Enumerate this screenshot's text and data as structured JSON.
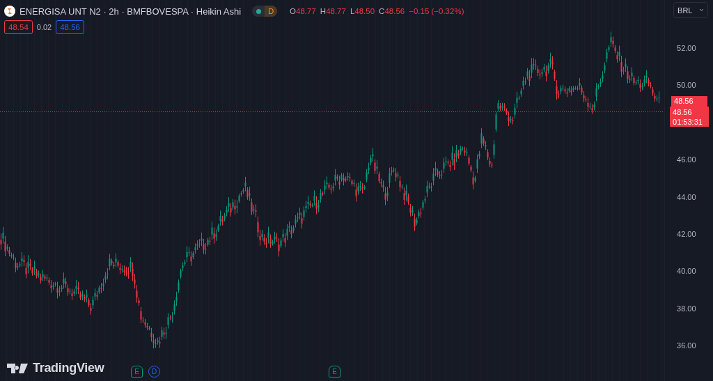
{
  "header": {
    "symbol": "ENERGISA UNT N2 · 2h · BMFBOVESPA · Heikin Ashi",
    "market_badge": "D",
    "ohlc": [
      {
        "label": "O",
        "value": "48.77"
      },
      {
        "label": "H",
        "value": "48.77"
      },
      {
        "label": "L",
        "value": "48.50"
      },
      {
        "label": "C",
        "value": "48.56"
      }
    ],
    "change": "−0.15 (−0.32%)"
  },
  "quote": {
    "bid": "48.54",
    "spread": "0.02",
    "ask": "48.56"
  },
  "currency": "BRL",
  "price_axis": [
    "52.00",
    "50.00",
    "46.00",
    "44.00",
    "42.00",
    "40.00",
    "38.00",
    "36.00"
  ],
  "last_price": {
    "price": "48.56",
    "close": "48.56",
    "countdown": "01:53:31"
  },
  "events": [
    {
      "kind": "earnings",
      "label": "E"
    },
    {
      "kind": "dividend",
      "label": "D"
    },
    {
      "kind": "earnings",
      "label": "E"
    }
  ],
  "brand": "TradingView"
}
